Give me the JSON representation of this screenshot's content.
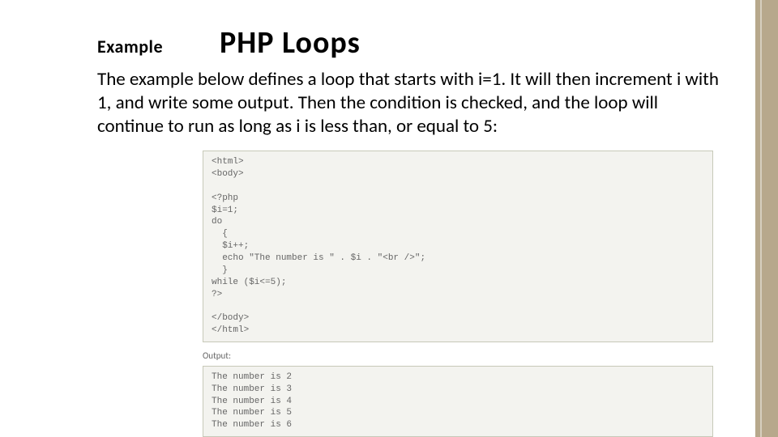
{
  "slide": {
    "example_label": "Example",
    "title": "PHP Loops",
    "description": "The example below defines a loop that starts with i=1. It will then increment i with 1, and write some output. Then the condition is checked, and the loop will continue to run as long as i is less than, or equal to 5:",
    "code": "<html>\n<body>\n\n<?php\n$i=1;\ndo\n  {\n  $i++;\n  echo \"The number is \" . $i . \"<br />\";\n  }\nwhile ($i<=5);\n?>\n\n</body>\n</html>",
    "output_label": "Output:",
    "output": "The number is 2\nThe number is 3\nThe number is 4\nThe number is 5\nThe number is 6"
  }
}
